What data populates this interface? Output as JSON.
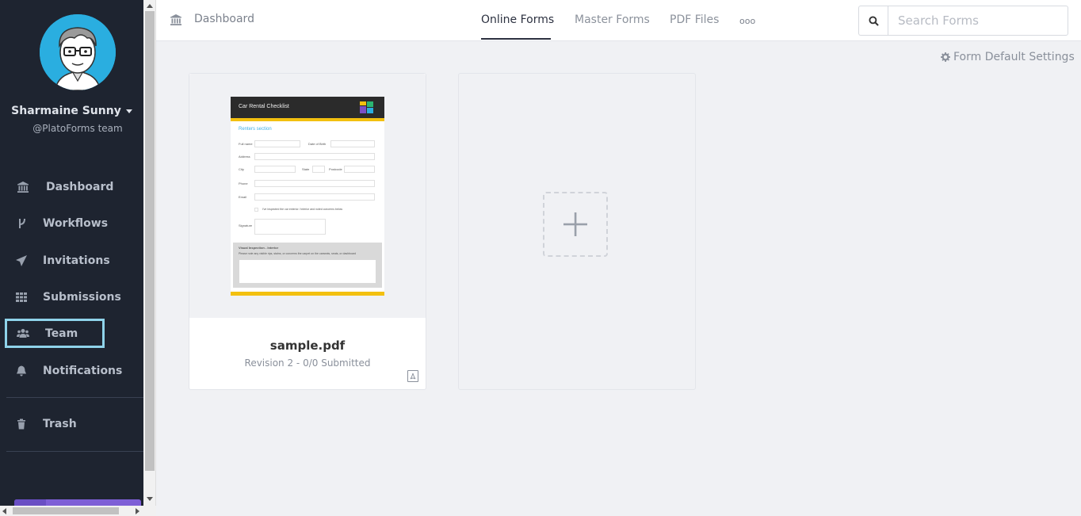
{
  "user": {
    "name": "Sharmaine Sunny",
    "team": "@PlatoForms team"
  },
  "sidebar": {
    "items": [
      {
        "label": "Dashboard",
        "icon": "bank-icon"
      },
      {
        "label": "Workflows",
        "icon": "branch-icon"
      },
      {
        "label": "Invitations",
        "icon": "paper-plane-icon"
      },
      {
        "label": "Submissions",
        "icon": "grid-icon"
      },
      {
        "label": "Team",
        "icon": "users-icon"
      },
      {
        "label": "Notifications",
        "icon": "bell-icon"
      },
      {
        "label": "Trash",
        "icon": "trash-icon"
      }
    ]
  },
  "header": {
    "breadcrumb": "Dashboard",
    "tabs": [
      {
        "label": "Online Forms",
        "active": true
      },
      {
        "label": "Master Forms",
        "active": false
      },
      {
        "label": "PDF Files",
        "active": false
      }
    ],
    "more": "ooo",
    "search_placeholder": "Search Forms"
  },
  "main": {
    "settings_link": "Form Default Settings",
    "forms": [
      {
        "title": "sample.pdf",
        "subtitle": "Revision 2 - 0/0 Submitted",
        "preview": {
          "title": "Car Rental Checklist",
          "section": "Renters section",
          "fields": [
            "Full name",
            "Date of Birth",
            "Address",
            "City",
            "State",
            "Postcode",
            "Phone",
            "Email",
            "I've inspected the car exterior / interior and noted concerns below",
            "Signature"
          ],
          "inspection_title": "Visual Inspection - Interior",
          "inspection_text": "Please note any visible rips, stains, or concerns the carpet on the carseats, seats, or dashboard"
        }
      }
    ]
  },
  "colors": {
    "sidebar_bg": "#1e2430",
    "accent_highlight": "#8fd3ea",
    "form_header_yellow": "#f3c00f",
    "avatar_bg": "#2aaee0"
  }
}
